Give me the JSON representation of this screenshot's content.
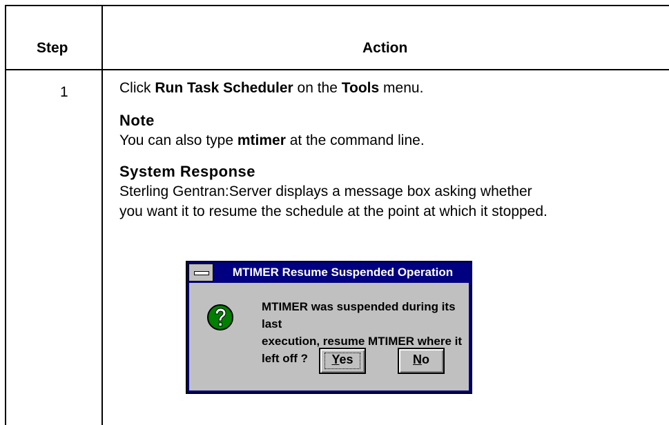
{
  "table": {
    "header_step": "Step",
    "header_action": "Action"
  },
  "row": {
    "step_number": "1",
    "instruction": {
      "prefix": "Click ",
      "command": "Run Task Scheduler",
      "middle": " on the ",
      "menu": "Tools",
      "suffix": " menu."
    },
    "note": {
      "label": "Note",
      "prefix": "You can also type ",
      "command": "mtimer",
      "suffix": " at the command line."
    },
    "system_response": {
      "label": "System Response",
      "line1": "Sterling Gentran:Server displays a message box asking whether",
      "line2": "you want it to resume the schedule at the point at which it stopped."
    }
  },
  "dialog": {
    "title": "MTIMER Resume Suspended Operation",
    "icon": "question-icon",
    "message_line1": "MTIMER was suspended during its last",
    "message_line2": "execution, resume MTIMER where it left off ?",
    "yes_mnemonic": "Y",
    "yes_rest": "es",
    "no_mnemonic": "N",
    "no_rest": "o",
    "colors": {
      "title_bar": "#000080",
      "face": "#c0c0c0",
      "icon": "#008000"
    }
  }
}
